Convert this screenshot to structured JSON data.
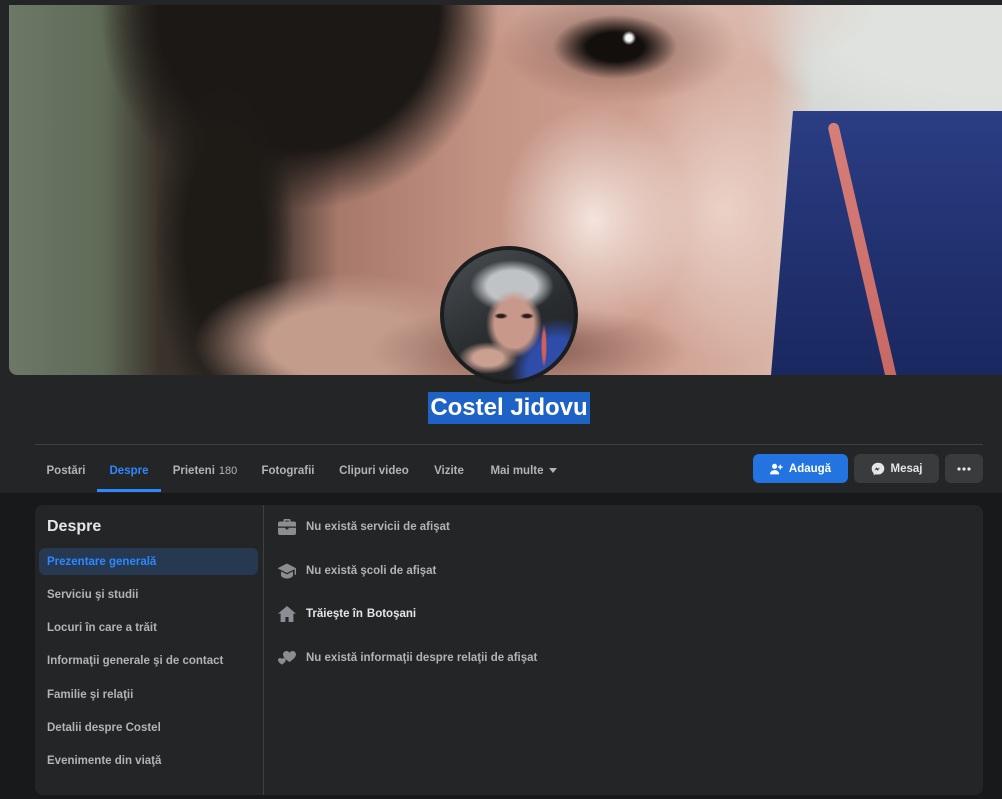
{
  "profile": {
    "name": "Costel Jidovu"
  },
  "tabs": [
    {
      "label": "Postări",
      "active": false
    },
    {
      "label": "Despre",
      "active": true
    },
    {
      "label": "Prieteni",
      "count": "180",
      "active": false
    },
    {
      "label": "Fotografii",
      "active": false
    },
    {
      "label": "Clipuri video",
      "active": false
    },
    {
      "label": "Vizite",
      "active": false
    },
    {
      "label": "Mai multe",
      "icon": "caret-down-icon",
      "active": false
    }
  ],
  "actions": {
    "add_friend": {
      "label": "Adaugă",
      "icon": "person-add-icon"
    },
    "message": {
      "label": "Mesaj",
      "icon": "messenger-icon"
    },
    "more": {
      "icon": "ellipsis-icon"
    }
  },
  "about": {
    "heading": "Despre",
    "menu": [
      {
        "label": "Prezentare generală",
        "active": true
      },
      {
        "label": "Serviciu şi studii",
        "active": false
      },
      {
        "label": "Locuri în care a trăit",
        "active": false
      },
      {
        "label": "Informaţii generale şi de contact",
        "active": false
      },
      {
        "label": "Familie şi relaţii",
        "active": false
      },
      {
        "label": "Detalii despre Costel",
        "active": false
      },
      {
        "label": "Evenimente din viaţă",
        "active": false
      }
    ],
    "overview": [
      {
        "icon": "briefcase-icon",
        "text": "Nu există servicii de afişat"
      },
      {
        "icon": "graduation-cap-icon",
        "text": "Nu există şcoli de afişat"
      },
      {
        "icon": "home-icon",
        "text": "Trăieşte în",
        "link": "Botoşani"
      },
      {
        "icon": "hearts-icon",
        "text": "Nu există informaţii despre relaţii de afişat"
      }
    ]
  },
  "colors": {
    "page_background": "#18191a",
    "surface": "#242526",
    "text_primary": "#e4e6eb",
    "text_secondary": "#b0b3b8",
    "accent": "#2d88ff",
    "primary_button": "#2374e1",
    "secondary_button": "#3a3b3c",
    "active_nav_background": "#263951",
    "divider": "#3e4042",
    "icon_gray": "#8a8d91",
    "name_selection_highlight": "#1f62c6"
  }
}
